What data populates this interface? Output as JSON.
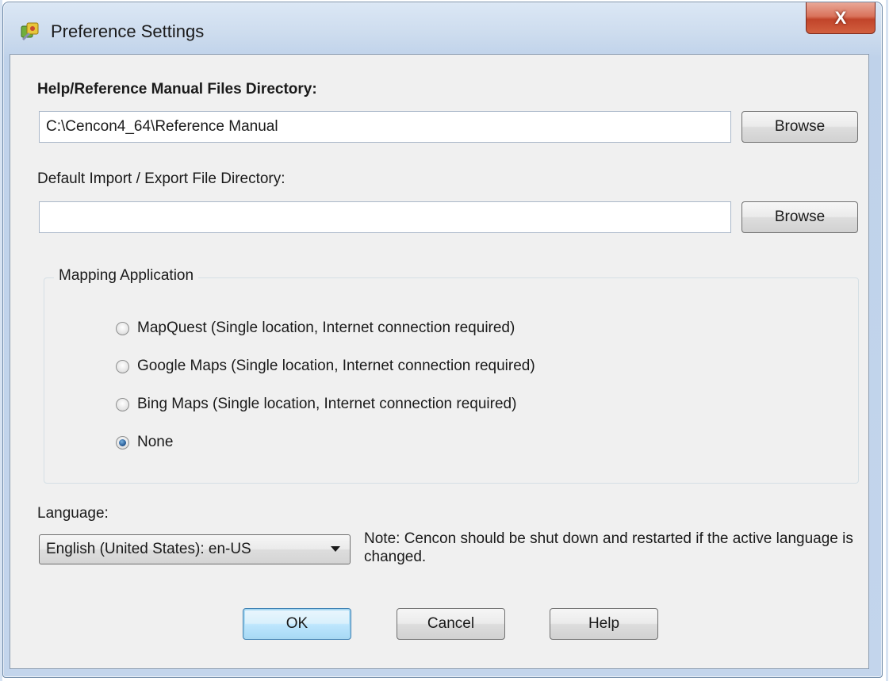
{
  "window": {
    "title": "Preference Settings",
    "close_glyph": "X",
    "app_icon": "preferences-app-icon"
  },
  "help_dir": {
    "label": "Help/Reference Manual Files Directory:",
    "value": "C:\\Cencon4_64\\Reference Manual",
    "browse_label": "Browse"
  },
  "import_export_dir": {
    "label": "Default Import / Export File Directory:",
    "value": "",
    "browse_label": "Browse"
  },
  "mapping": {
    "group_title": "Mapping Application",
    "options": [
      {
        "label": "MapQuest (Single location, Internet connection required)",
        "checked": false
      },
      {
        "label": "Google Maps (Single location, Internet connection required)",
        "checked": false
      },
      {
        "label": "Bing Maps (Single location, Internet connection required)",
        "checked": false
      },
      {
        "label": "None",
        "checked": true
      }
    ]
  },
  "language": {
    "label": "Language:",
    "selected": "English (United States):  en-US",
    "note": "Note: Cencon should be shut down and restarted if the active language is changed."
  },
  "buttons": {
    "ok": "OK",
    "cancel": "Cancel",
    "help": "Help"
  },
  "colors": {
    "close_button": "#c8503a",
    "default_button_border": "#3c7fb1",
    "dialog_background": "#f0f0f0"
  }
}
